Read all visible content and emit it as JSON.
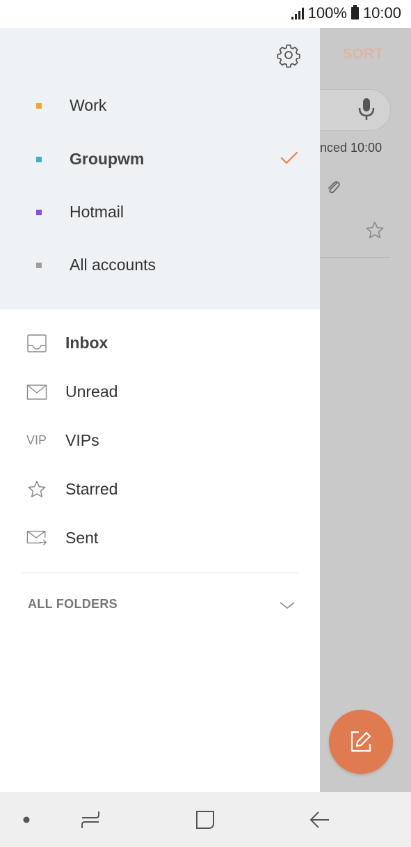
{
  "status_bar": {
    "battery": "100%",
    "time": "10:00"
  },
  "background_app": {
    "sort_label": "SORT",
    "email_meta": "nced  10:00"
  },
  "accounts": [
    {
      "label": "Work",
      "color": "#f0a43a",
      "selected": false
    },
    {
      "label": "Groupwm",
      "color": "#3fb2c4",
      "selected": true
    },
    {
      "label": "Hotmail",
      "color": "#8a4fd6",
      "selected": false
    },
    {
      "label": "All accounts",
      "color": "#9e9e9e",
      "selected": false
    }
  ],
  "folders": [
    {
      "label": "Inbox",
      "icon": "inbox-icon",
      "bold": true
    },
    {
      "label": "Unread",
      "icon": "envelope-icon"
    },
    {
      "label": "VIPs",
      "icon": "vip-icon",
      "icon_text": "VIP"
    },
    {
      "label": "Starred",
      "icon": "star-icon"
    },
    {
      "label": "Sent",
      "icon": "sent-icon"
    }
  ],
  "all_folders_label": "ALL FOLDERS",
  "colors": {
    "accent": "#f08a5d",
    "fab": "#e07a50"
  }
}
